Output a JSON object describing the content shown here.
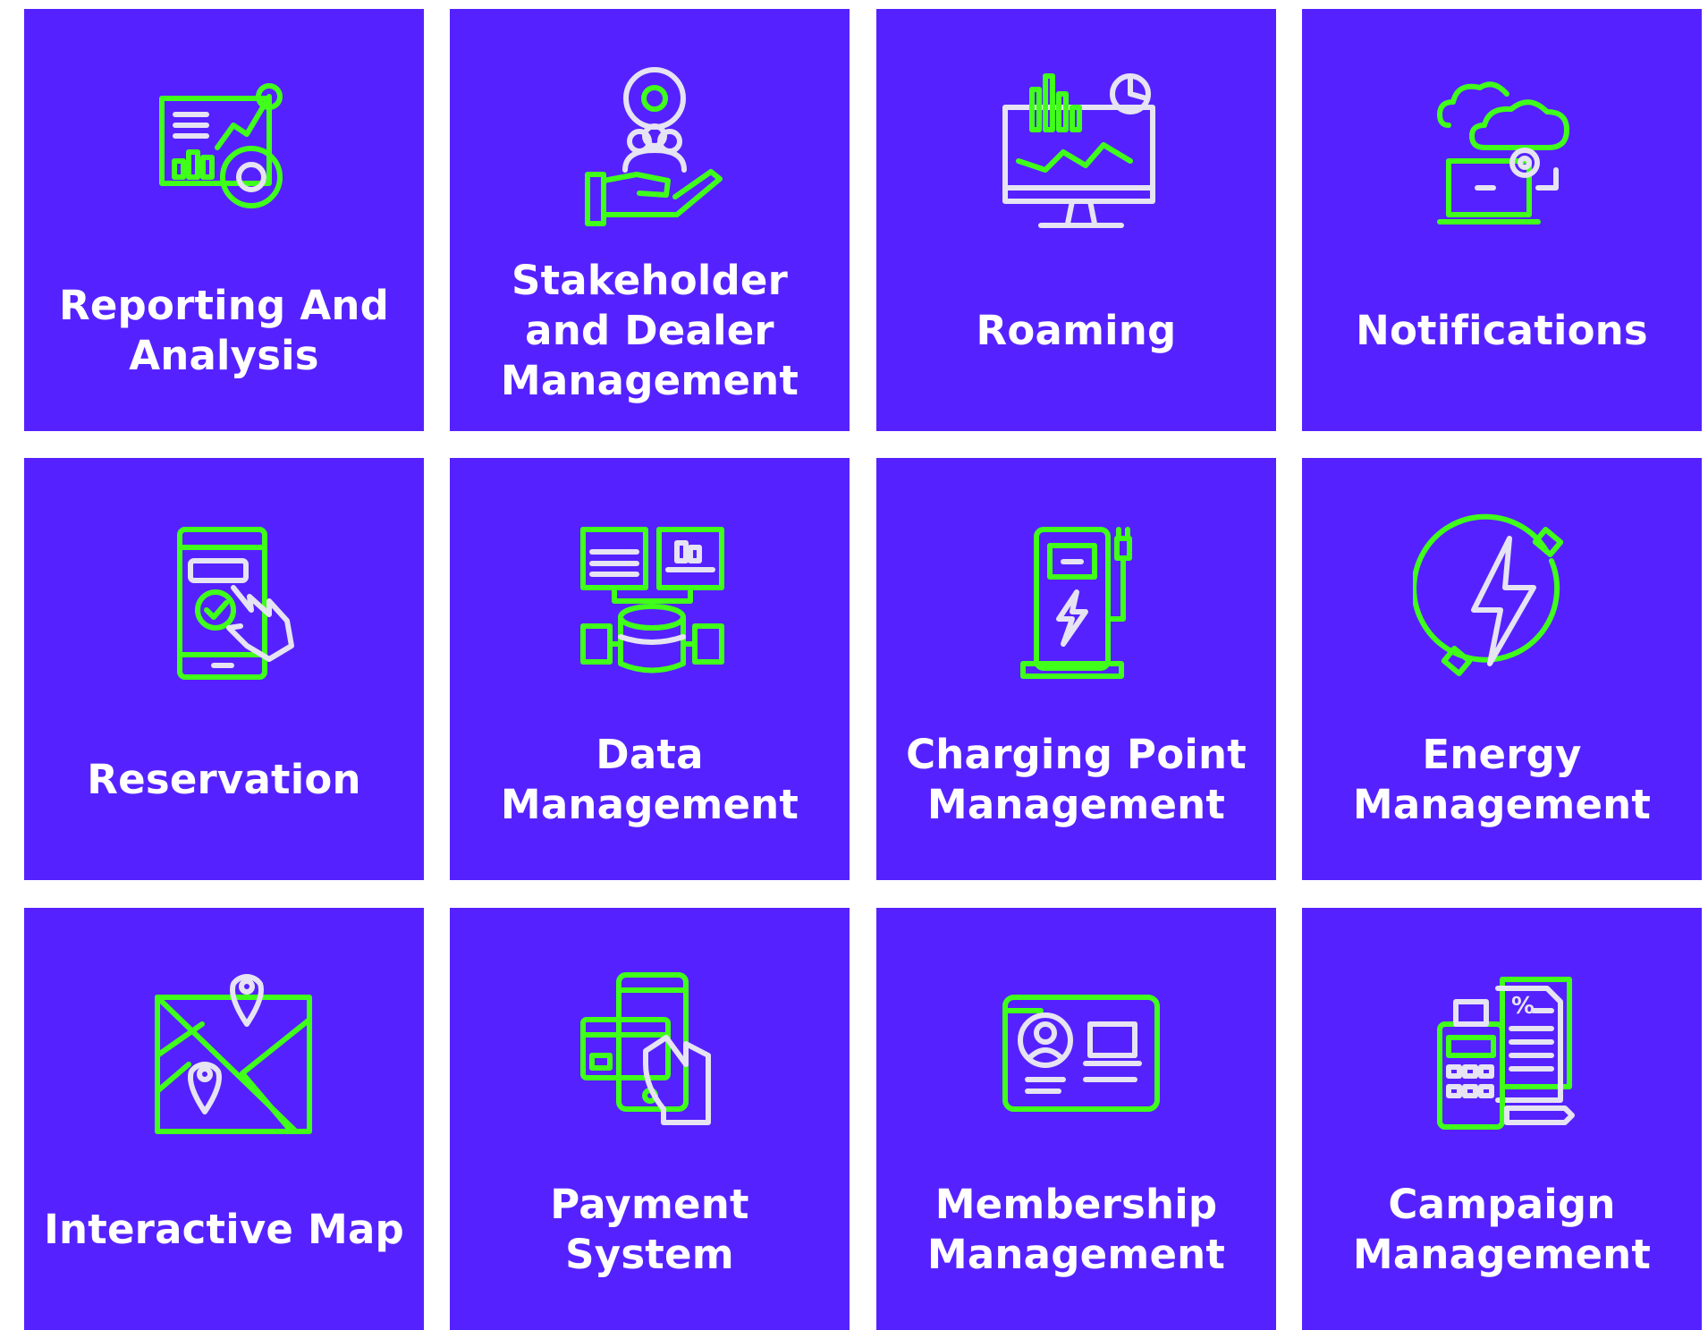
{
  "features": [
    {
      "label": "Reporting And Analysis",
      "icon": "analytics-report-icon"
    },
    {
      "label": "Stakeholder and Dealer Management",
      "icon": "stakeholder-hand-icon"
    },
    {
      "label": "Roaming",
      "icon": "monitor-chart-icon"
    },
    {
      "label": "Notifications",
      "icon": "cloud-laptop-gear-icon"
    },
    {
      "label": "Reservation",
      "icon": "phone-tap-check-icon"
    },
    {
      "label": "Data Management",
      "icon": "database-network-icon"
    },
    {
      "label": "Charging Point Management",
      "icon": "charging-station-icon"
    },
    {
      "label": "Energy Management",
      "icon": "energy-plug-cycle-icon"
    },
    {
      "label": "Interactive Map",
      "icon": "map-pins-icon"
    },
    {
      "label": "Payment System",
      "icon": "phone-card-payment-icon"
    },
    {
      "label": "Membership Management",
      "icon": "membership-card-icon"
    },
    {
      "label": "Campaign Management",
      "icon": "pos-terminal-invoice-icon"
    }
  ],
  "colors": {
    "tile": "#5522ff",
    "accent": "#40ff1a",
    "icon_light": "#e6e3f2",
    "text": "#ffffff"
  }
}
